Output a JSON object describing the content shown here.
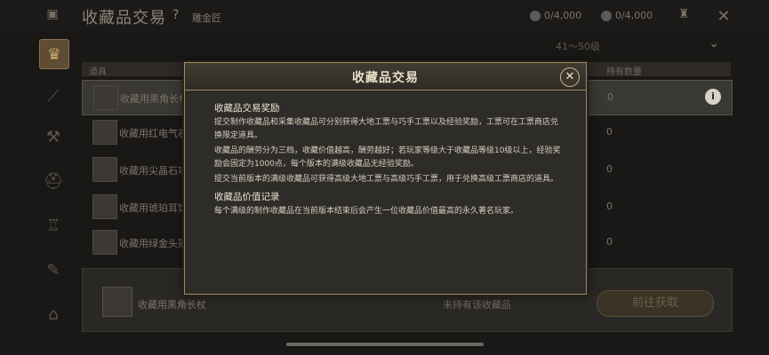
{
  "top": {
    "title": "收藏品交易",
    "help": "?",
    "subtitle": "雕金匠",
    "currency1": "0/4,000",
    "currency2": "0/4,000"
  },
  "level_select": {
    "label": "41～50级"
  },
  "table": {
    "col_name": "道具",
    "col_count": "持有数量",
    "rows": [
      {
        "name": "收藏用黑角长杖",
        "count": "0"
      },
      {
        "name": "收藏用红电气石",
        "count": "0"
      },
      {
        "name": "收藏用尖晶石项",
        "count": "0"
      },
      {
        "name": "收藏用琥珀耳饰",
        "count": "0"
      },
      {
        "name": "收藏用绿金头冠",
        "count": "0"
      }
    ]
  },
  "bottom": {
    "item_name": "收藏用黑角长杖",
    "status": "未持有该收藏品",
    "goto_label": "前往获取"
  },
  "modal": {
    "title": "收藏品交易",
    "section1_heading": "收藏品交易奖励",
    "section1_p1": "提交制作收藏品和采集收藏品可分别获得大地工票与巧手工票以及经验奖励，工票可在工票商店兑换限定道具。",
    "section1_p2": "收藏品的酬劳分为三档，收藏价值越高，酬劳越好；若玩家等级大于收藏品等级10级以上，经验奖励会固定为1000点，每个版本的满级收藏品无经验奖励。",
    "section1_p3": "提交当前版本的满级收藏品可获得高级大地工票与高级巧手工票，用于兑换高级工票商店的道具。",
    "section2_heading": "收藏品价值记录",
    "section2_p1": "每个满级的制作收藏品在当前版本结束后会产生一位收藏品价值最高的永久著名玩家。"
  }
}
